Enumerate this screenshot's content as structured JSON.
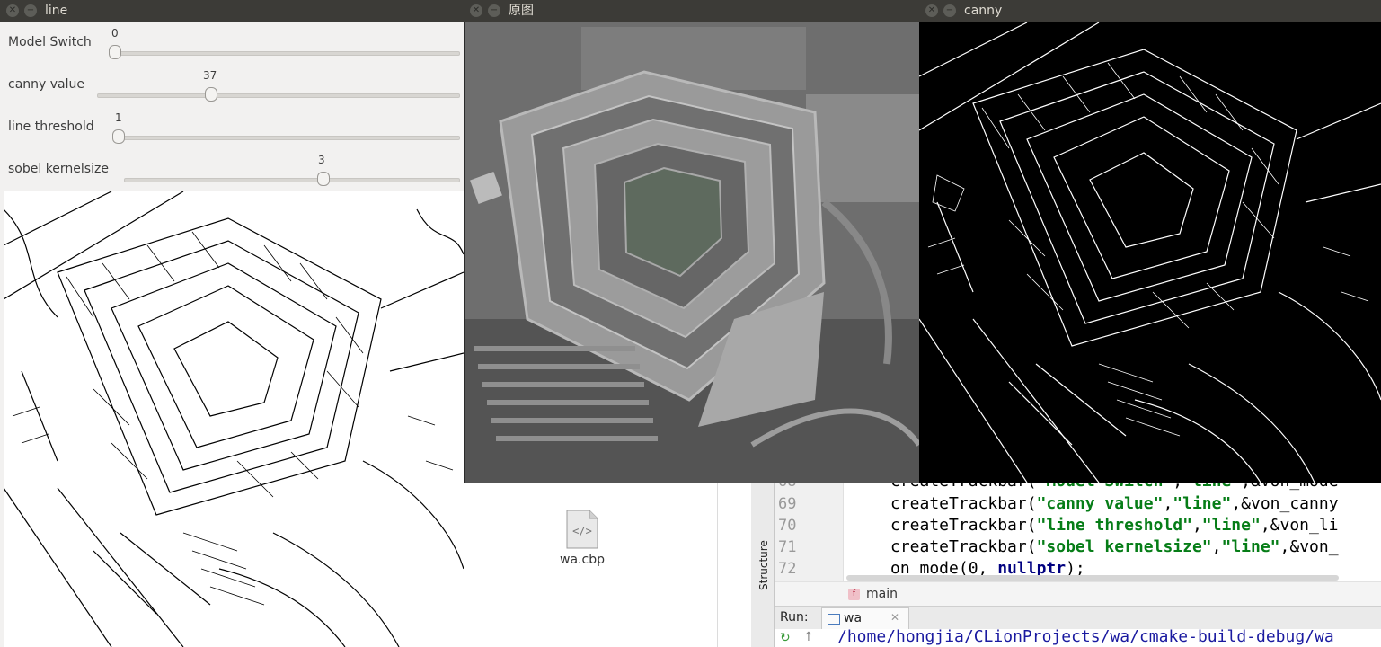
{
  "windows": {
    "line": {
      "title": "line"
    },
    "original": {
      "title": "原图"
    },
    "canny": {
      "title": "canny"
    }
  },
  "trackbars": [
    {
      "label": "Model Switch",
      "value": "0"
    },
    {
      "label": "canny value",
      "value": "37"
    },
    {
      "label": "line threshold",
      "value": "1"
    },
    {
      "label": "sobel kernelsize",
      "value": "3"
    }
  ],
  "file_manager": {
    "file_name": "wa.cbp",
    "icon": "code-file-icon"
  },
  "editor": {
    "lines": [
      {
        "number": "68",
        "fn": "createTrackbar(",
        "arg1": "\"Model Switch\"",
        "sep": ",",
        "arg2": "\"line\"",
        "rest": ",&von_mode"
      },
      {
        "number": "69",
        "fn": "createTrackbar(",
        "arg1": "\"canny value\"",
        "sep": ",",
        "arg2": "\"line\"",
        "rest": ",&von_canny"
      },
      {
        "number": "70",
        "fn": "createTrackbar(",
        "arg1": "\"line threshold\"",
        "sep": ",",
        "arg2": "\"line\"",
        "rest": ",&von_li"
      },
      {
        "number": "71",
        "fn": "createTrackbar(",
        "arg1": "\"sobel kernelsize\"",
        "sep": ",",
        "arg2": "\"line\"",
        "rest": ",&von_"
      },
      {
        "number": "72",
        "fn": "on_mode(0, ",
        "kw": "nullptr",
        "rest": ");"
      }
    ],
    "breadcrumb": "main",
    "side_tab": "Structure"
  },
  "run_panel": {
    "label": "Run:",
    "tab": "wa",
    "path": "/home/hongjia/CLionProjects/wa/cmake-build-debug/wa"
  },
  "colors": {
    "titlebar": "#3c3b37",
    "string": "#067d17",
    "keyword": "#000080"
  }
}
